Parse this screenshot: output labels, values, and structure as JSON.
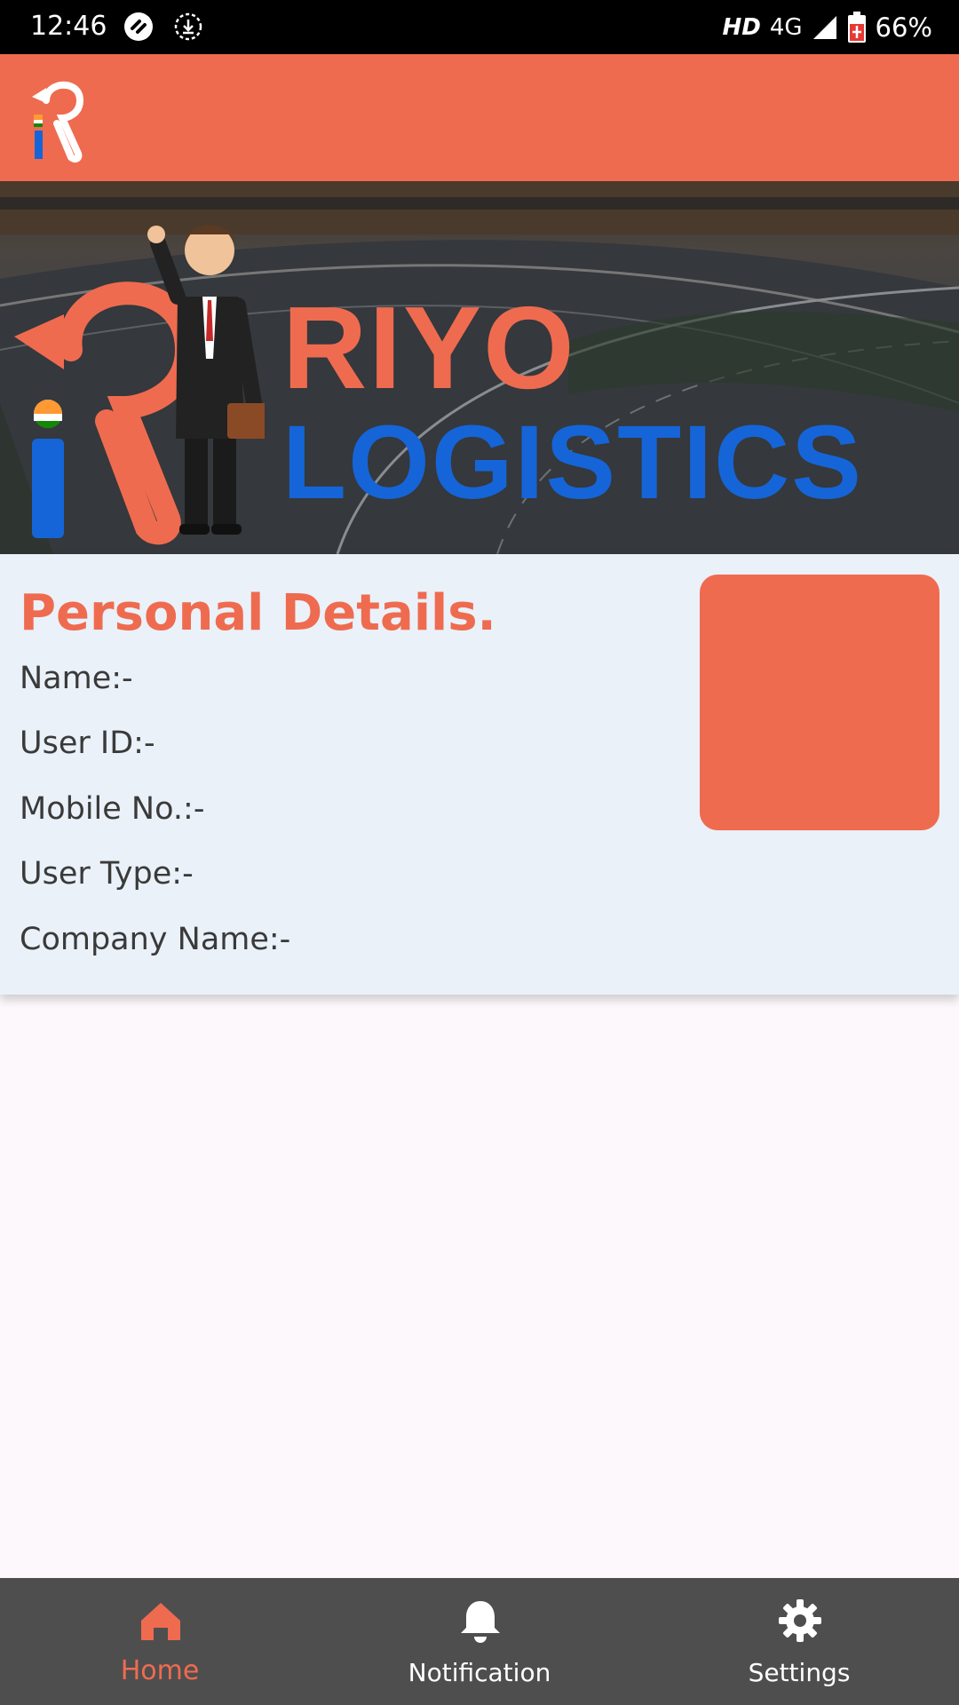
{
  "status_bar": {
    "time": "12:46",
    "network_label": "HD",
    "network_type": "4G",
    "battery": "66%"
  },
  "banner": {
    "brand_line1": "RIYO",
    "brand_line2": "LOGISTICS"
  },
  "personal_details": {
    "title": "Personal Details.",
    "fields": [
      {
        "label": "Name:-"
      },
      {
        "label": "User ID:-"
      },
      {
        "label": "Mobile No.:-"
      },
      {
        "label": "User Type:-"
      },
      {
        "label": "Company Name:-"
      }
    ]
  },
  "bottom_nav": {
    "items": [
      {
        "label": "Home",
        "icon": "home-icon",
        "active": true
      },
      {
        "label": "Notification",
        "icon": "bell-icon",
        "active": false
      },
      {
        "label": "Settings",
        "icon": "gear-icon",
        "active": false
      }
    ]
  },
  "colors": {
    "accent": "#ef6b4f",
    "brand_blue": "#1565d8",
    "nav_background": "#4f4e4f",
    "card_background": "#eaf1f9"
  }
}
